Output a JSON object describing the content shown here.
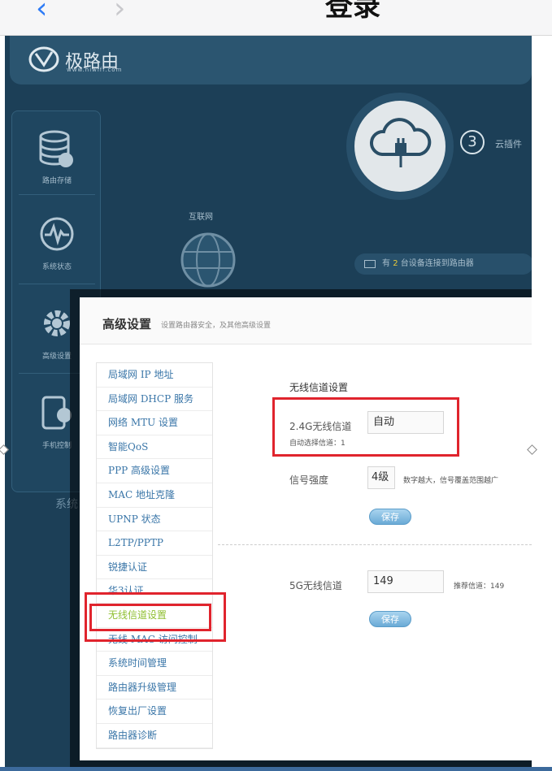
{
  "topbar": {
    "back_glyph": "‹",
    "forward_glyph": "›",
    "title": "登录"
  },
  "app": {
    "logo_name": "极路由",
    "logo_url": "www.hiwifi.com",
    "sidebar": [
      {
        "label": "路由存储",
        "icon": "database-icon"
      },
      {
        "label": "系统状态",
        "icon": "pulse-icon"
      },
      {
        "label": "高级设置",
        "icon": "gear-icon"
      },
      {
        "label": "手机控制",
        "icon": "phone-icon"
      }
    ],
    "cloud_step": "3",
    "cloud_label": "云插件",
    "internet_label": "互联网",
    "devices_prefix": "有",
    "devices_count": "2",
    "devices_suffix": "台设备连接到路由器",
    "sys_label": "系统"
  },
  "panel": {
    "title": "高级设置",
    "subtitle": "设置路由器安全，及其他高级设置",
    "menu": [
      "局域网 IP 地址",
      "局域网 DHCP 服务",
      "网络 MTU 设置",
      "智能QoS",
      "PPP 高级设置",
      "MAC 地址克隆",
      "UPNP 状态",
      "L2TP/PPTP",
      "锐捷认证",
      "华3认证",
      "无线信道设置",
      "无线 MAC 访问控制",
      "系统时间管理",
      "路由器升级管理",
      "恢复出厂设置",
      "路由器诊断"
    ],
    "active_index": 10,
    "section_title": "无线信道设置",
    "ch24_label": "2.4G无线信道",
    "ch24_value": "自动",
    "ch24_hint": "自动选择信道：1",
    "signal_label": "信号强度",
    "signal_value": "4级",
    "signal_hint": "数字越大，信号覆盖范围越广",
    "save_label": "保存",
    "ch5_label": "5G无线信道",
    "ch5_value": "149",
    "ch5_hint": "推荐信道：149",
    "colors": {
      "highlight": "#e0242d",
      "link": "#3a76a8",
      "active": "#8fbf32"
    }
  }
}
